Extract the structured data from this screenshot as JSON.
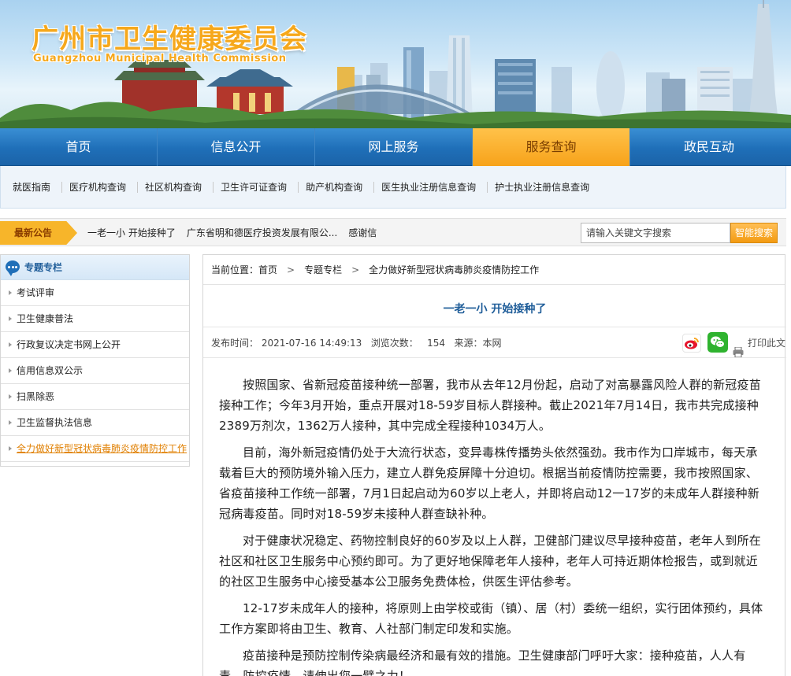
{
  "site": {
    "title": "广州市卫生健康委员会",
    "subtitle": "Guangzhou Municipal Health Commission"
  },
  "main_nav": [
    {
      "label": "首页"
    },
    {
      "label": "信息公开"
    },
    {
      "label": "网上服务"
    },
    {
      "label": "服务查询",
      "active": true
    },
    {
      "label": "政民互动"
    }
  ],
  "sub_nav": [
    {
      "label": "就医指南"
    },
    {
      "label": "医疗机构查询"
    },
    {
      "label": "社区机构查询"
    },
    {
      "label": "卫生许可证查询"
    },
    {
      "label": "助产机构查询"
    },
    {
      "label": "医生执业注册信息查询"
    },
    {
      "label": "护士执业注册信息查询"
    }
  ],
  "notice": {
    "label": "最新公告",
    "items": [
      {
        "text": "一老一小 开始接种了"
      },
      {
        "text": "广东省明和德医疗投资发展有限公..."
      },
      {
        "text": "感谢信"
      }
    ]
  },
  "search": {
    "placeholder": "请输入关键文字搜索",
    "button_label": "智能搜索"
  },
  "sidebar": {
    "title": "专题专栏",
    "items": [
      {
        "label": "考试评审"
      },
      {
        "label": "卫生健康普法"
      },
      {
        "label": "行政复议决定书网上公开"
      },
      {
        "label": "信用信息双公示"
      },
      {
        "label": "扫黑除恶"
      },
      {
        "label": "卫生监督执法信息"
      },
      {
        "label": "全力做好新型冠状病毒肺炎疫情防控工作",
        "active": true
      }
    ]
  },
  "breadcrumb": {
    "prefix": "当前位置：",
    "items": [
      "首页",
      "专题专栏",
      "全力做好新型冠状病毒肺炎疫情防控工作"
    ],
    "separator": ">"
  },
  "article": {
    "title": "一老一小  开始接种了",
    "meta": "发布时间： 2021-07-16 14:49:13   浏览次数：   154   来源：本网",
    "print_label": "打印此文",
    "paragraphs": [
      "按照国家、省新冠疫苗接种统一部署，我市从去年12月份起，启动了对高暴露风险人群的新冠疫苗接种工作；今年3月开始，重点开展对18-59岁目标人群接种。截止2021年7月14日，我市共完成接种2389万剂次，1362万人接种，其中完成全程接种1034万人。",
      "目前，海外新冠疫情仍处于大流行状态，变异毒株传播势头依然强劲。我市作为口岸城市，每天承载着巨大的预防境外输入压力，建立人群免疫屏障十分迫切。根据当前疫情防控需要，我市按照国家、省疫苗接种工作统一部署，7月1日起启动为60岁以上老人，并即将启动12一17岁的未成年人群接种新冠病毒疫苗。同时对18-59岁未接种人群查缺补种。",
      "对于健康状况稳定、药物控制良好的60岁及以上人群，卫健部门建议尽早接种疫苗，老年人到所在社区和社区卫生服务中心预约即可。为了更好地保障老年人接种，老年人可持近期体检报告，或到就近的社区卫生服务中心接受基本公卫服务免费体检，供医生评估参考。",
      "12-17岁未成年人的接种，将原则上由学校或街（镇）、居（村）委统一组织，实行团体预约，具体工作方案即将由卫生、教育、人社部门制定印发和实施。",
      "疫苗接种是预防控制传染病最经济和最有效的措施。卫生健康部门呼吁大家：接种疫苗，人人有责，防控疫情，请伸出您一臂之力！"
    ]
  },
  "colors": {
    "nav_blue": "#1f6fb8",
    "nav_active_orange": "#f7a21a",
    "title_orange": "#f6a81c",
    "link_blue": "#1f5d99",
    "sidebar_active": "#e07f00"
  }
}
